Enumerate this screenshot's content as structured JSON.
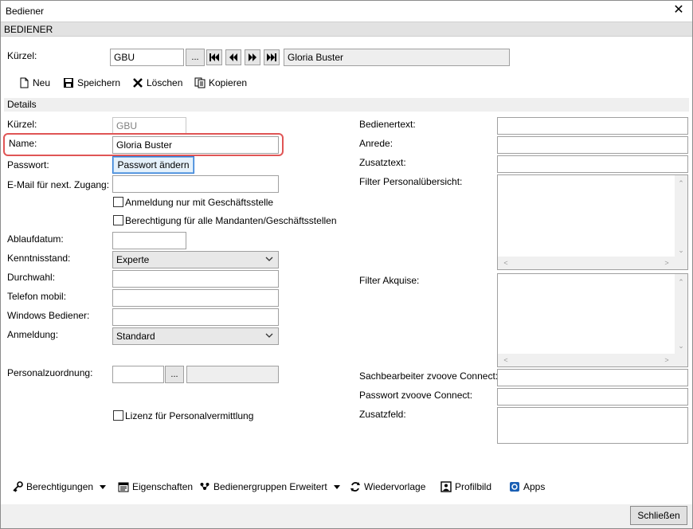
{
  "window": {
    "title": "Bediener",
    "close_glyph": "✕"
  },
  "section": {
    "header": "BEDIENER"
  },
  "top": {
    "kuerzel_label": "Kürzel:",
    "kuerzel_value": "GBU",
    "browse_label": "...",
    "name_display": "Gloria Buster"
  },
  "toolbar": {
    "neu": "Neu",
    "speichern": "Speichern",
    "loeschen": "Löschen",
    "kopieren": "Kopieren"
  },
  "details": {
    "header": "Details",
    "kuerzel_label": "Kürzel:",
    "kuerzel_value": "GBU",
    "name_label": "Name:",
    "name_value": "Gloria Buster",
    "passwort_label": "Passwort:",
    "passwort_button": "Passwort ändern",
    "email_label": "E-Mail für next. Zugang:",
    "email_value": "",
    "cb_anmeldung": "Anmeldung nur mit Geschäftsstelle",
    "cb_berechtigung": "Berechtigung für alle Mandanten/Geschäftsstellen",
    "ablauf_label": "Ablaufdatum:",
    "ablauf_value": "",
    "kenntnis_label": "Kenntnisstand:",
    "kenntnis_value": "Experte",
    "durchwahl_label": "Durchwahl:",
    "telefon_label": "Telefon mobil:",
    "windows_label": "Windows Bediener:",
    "anmeldung_label": "Anmeldung:",
    "anmeldung_value": "Standard",
    "personal_label": "Personalzuordnung:",
    "personal_browse": "...",
    "cb_lizenz": "Lizenz für Personalvermittlung"
  },
  "right": {
    "bedienertext_label": "Bedienertext:",
    "anrede_label": "Anrede:",
    "zusatztext_label": "Zusatztext:",
    "filter_personal_label": "Filter Personalübersicht:",
    "filter_akquise_label": "Filter Akquise:",
    "sachbearbeiter_label": "Sachbearbeiter zvoove Connect:",
    "passwort_connect_label": "Passwort zvoove Connect:",
    "zusatzfeld_label": "Zusatzfeld:"
  },
  "bottom_toolbar": {
    "berechtigungen": "Berechtigungen",
    "eigenschaften": "Eigenschaften",
    "bedienergruppen": "Bedienergruppen Erweitert",
    "wiedervorlage": "Wiedervorlage",
    "profilbild": "Profilbild",
    "apps": "Apps"
  },
  "footer": {
    "schliessen": "Schließen"
  },
  "icons": {
    "nav": [
      "first-icon",
      "previous-icon",
      "next-icon",
      "last-icon"
    ],
    "toolbar": [
      "new-document-icon",
      "save-icon",
      "delete-icon",
      "copy-icon"
    ],
    "bottom": [
      "key-icon",
      "properties-icon",
      "group-icon",
      "followup-icon",
      "profile-picture-icon",
      "apps-icon"
    ]
  },
  "colors": {
    "highlight": "#e05555",
    "focus": "#2f7bd6",
    "section_bg": "#e2e2e2"
  }
}
